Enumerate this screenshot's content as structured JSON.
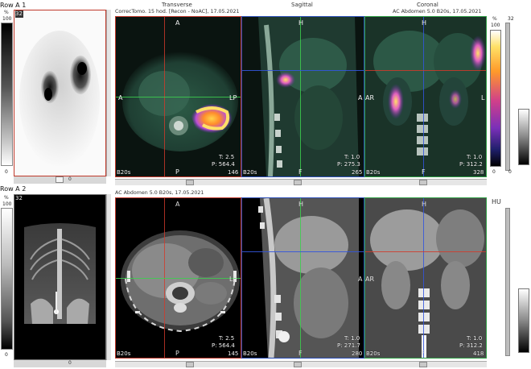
{
  "row_a1": {
    "label": "Row A 1",
    "percent_label": "%",
    "scale_top": "100",
    "scale_bottom": "0",
    "frame_number": "32",
    "bottom_marker": "0"
  },
  "row_a2": {
    "label": "Row A 2",
    "percent_label": "%",
    "scale_top": "100",
    "scale_bottom": "0",
    "frame_number": "32",
    "bottom_marker": "0"
  },
  "fusion": {
    "series_left": "CorrecTomo. 15 hod. [Recon - NoAC], 17.05.2021",
    "series_right": "AC Abdomen 5.0 B20s, 17.05.2021",
    "views": {
      "transverse": "Transverse",
      "sagittal": "Sagittal",
      "coronal": "Coronal"
    },
    "colorbar": {
      "percent_label": "%",
      "top": "100",
      "bottom": "0",
      "right_top": "32",
      "right_bottom": "0"
    },
    "transverse": {
      "top": "A",
      "left": "A",
      "right": "LP",
      "bottom": "P",
      "t_value": "T: 2.5",
      "p_value": "P: 564.4",
      "kernel": "B20s",
      "slice": "146"
    },
    "sagittal": {
      "top": "H",
      "left": "A",
      "bottom": "F",
      "t_value": "T: 1.0",
      "p_value": "P: 275.3",
      "kernel": "B20s",
      "slice": "265"
    },
    "coronal": {
      "top": "H",
      "left": "AR",
      "right": "L",
      "bottom": "F",
      "t_value": "T: 1.0",
      "p_value": "P: 312.2",
      "kernel": "B20s",
      "slice": "328"
    }
  },
  "ct": {
    "series": "AC Abdomen 5.0 B20s, 17.05.2021",
    "hu_label": "HU",
    "transverse": {
      "top": "A",
      "left": "D",
      "right": "LP",
      "bottom": "P",
      "t_value": "T: 2.5",
      "p_value": "P: 564.4",
      "kernel": "B20s",
      "slice": "145"
    },
    "sagittal": {
      "top": "H",
      "left": "A",
      "bottom": "F",
      "t_value": "T: 1.0",
      "p_value": "P: 271.7",
      "kernel": "B20s",
      "slice": "280"
    },
    "coronal": {
      "top": "H",
      "left": "AR",
      "bottom": "F",
      "t_value": "T: 1.0",
      "p_value": "P: 312.2",
      "kernel": "B20s",
      "slice": "418"
    }
  },
  "fusion_hu_label": "HU",
  "colors": {
    "border_red": "#c0392b",
    "border_green": "#2e9e44",
    "border_blue": "#2c4fb8",
    "crosshair_green": "#3ccf4e",
    "crosshair_blue": "#3355dd",
    "crosshair_red": "#d23a2a"
  }
}
